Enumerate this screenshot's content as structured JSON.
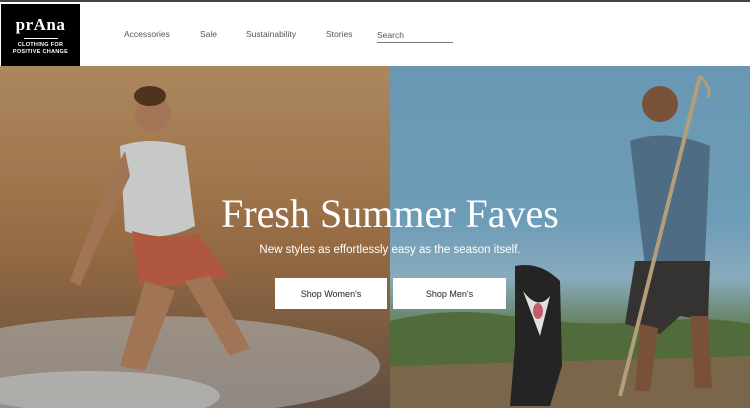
{
  "brand": {
    "wordmark": "prAna",
    "tagline_line1": "CLOTHING FOR",
    "tagline_line2": "POSITIVE CHANGE"
  },
  "nav": {
    "items": [
      {
        "label": "Accessories"
      },
      {
        "label": "Sale"
      },
      {
        "label": "Sustainability"
      },
      {
        "label": "Stories"
      }
    ],
    "search_placeholder": "Search"
  },
  "hero": {
    "headline": "Fresh Summer Faves",
    "subheadline": "New styles as effortlessly easy as the season itself.",
    "buttons": [
      {
        "label": "Shop Women's"
      },
      {
        "label": "Shop Men's"
      }
    ]
  }
}
